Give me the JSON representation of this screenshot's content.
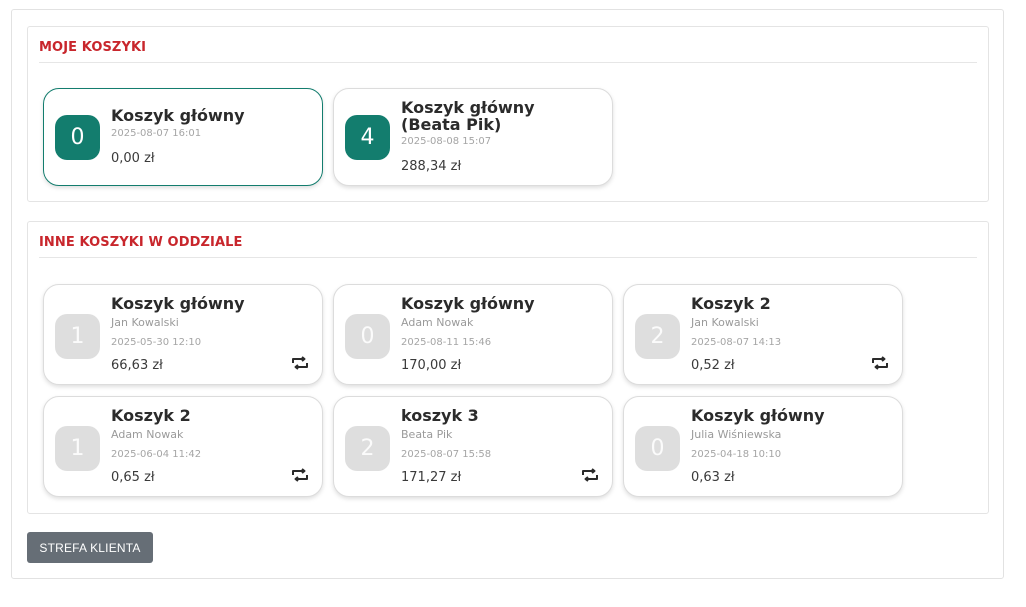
{
  "my_carts": {
    "title": "MOJE KOSZYKI",
    "cards": [
      {
        "count": "0",
        "name": "Koszyk główny",
        "date": "2025-08-07 16:01",
        "amount": "0,00 zł"
      },
      {
        "count": "4",
        "name_line1": "Koszyk główny",
        "name_line2": "(Beata Pik)",
        "date": "2025-08-08 15:07",
        "amount": "288,34 zł"
      }
    ]
  },
  "other_carts": {
    "title": "INNE KOSZYKI W ODDZIALE",
    "cards": [
      {
        "count": "1",
        "name": "Koszyk główny",
        "owner": "Jan Kowalski",
        "date": "2025-05-30 12:10",
        "amount": "66,63 zł",
        "icon": "repeat-icon"
      },
      {
        "count": "0",
        "name": "Koszyk główny",
        "owner": "Adam Nowak",
        "date": "2025-08-11 15:46",
        "amount": "170,00 zł"
      },
      {
        "count": "2",
        "name": "Koszyk 2",
        "owner": "Jan Kowalski",
        "date": "2025-08-07 14:13",
        "amount": "0,52 zł",
        "icon": "repeat-icon"
      },
      {
        "count": "1",
        "name": "Koszyk 2",
        "owner": "Adam Nowak",
        "date": "2025-06-04 11:42",
        "amount": "0,65 zł",
        "icon": "repeat-icon"
      },
      {
        "count": "2",
        "name": "koszyk 3",
        "owner": "Beata Pik",
        "date": "2025-08-07 15:58",
        "amount": "171,27 zł",
        "icon": "repeat-icon"
      },
      {
        "count": "0",
        "name": "Koszyk główny",
        "owner": "Julia Wiśniewska",
        "date": "2025-04-18 10:10",
        "amount": "0,63 zł"
      }
    ]
  },
  "client_zone_button": "STREFA KLIENTA",
  "colors": {
    "accent_teal": "#137d6e",
    "section_title_red": "#c8262c",
    "button_grey": "#666e76"
  }
}
